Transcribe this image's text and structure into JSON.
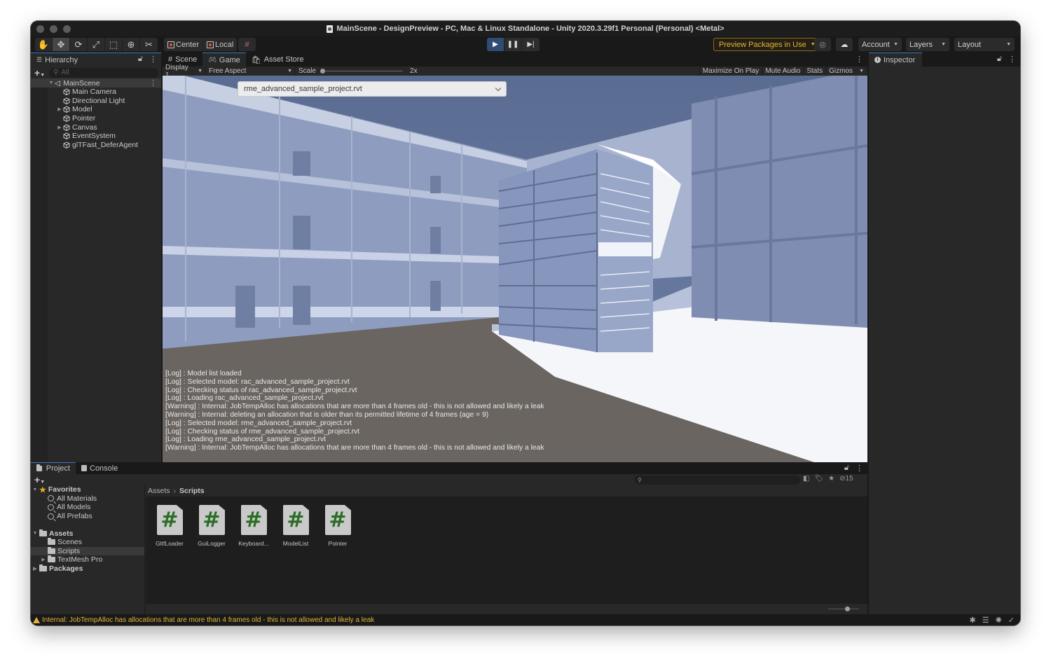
{
  "window": {
    "title": "MainScene - DesignPreview - PC, Mac & Linux Standalone - Unity 2020.3.29f1 Personal (Personal) <Metal>"
  },
  "toolbar": {
    "tools": [
      {
        "name": "hand-tool",
        "glyph": "✋"
      },
      {
        "name": "move-tool",
        "glyph": "✥"
      },
      {
        "name": "rotate-tool",
        "glyph": "⟳"
      },
      {
        "name": "scale-tool",
        "glyph": "⤢"
      },
      {
        "name": "rect-tool",
        "glyph": "⬚"
      },
      {
        "name": "transform-tool",
        "glyph": "⊕"
      },
      {
        "name": "custom-tool",
        "glyph": "✂"
      }
    ],
    "pivot_label": "Center",
    "space_label": "Local",
    "grid_snap_glyph": "#",
    "preview_packages_label": "Preview Packages in Use",
    "account_label": "Account",
    "layers_label": "Layers",
    "layout_label": "Layout"
  },
  "hierarchy": {
    "tab_label": "Hierarchy",
    "search_placeholder": "All",
    "scene": "MainScene",
    "items": [
      {
        "label": "Main Camera",
        "expandable": false
      },
      {
        "label": "Directional Light",
        "expandable": false
      },
      {
        "label": "Model",
        "expandable": true
      },
      {
        "label": "Pointer",
        "expandable": false
      },
      {
        "label": "Canvas",
        "expandable": true
      },
      {
        "label": "EventSystem",
        "expandable": false
      },
      {
        "label": "glTFast_DeferAgent",
        "expandable": false
      }
    ]
  },
  "game_view": {
    "tabs": [
      {
        "label": "Scene",
        "active": false
      },
      {
        "label": "Game",
        "active": true
      },
      {
        "label": "Asset Store",
        "active": false
      }
    ],
    "display": "Display 1",
    "aspect": "Free Aspect",
    "scale_label": "Scale",
    "scale_value": "2x",
    "scale_fraction": 0.0,
    "options": [
      "Maximize On Play",
      "Mute Audio",
      "Stats",
      "Gizmos"
    ],
    "model_dropdown_value": "rme_advanced_sample_project.rvt",
    "log_lines": [
      "[Log] : Model list loaded",
      "[Log] : Selected model: rac_advanced_sample_project.rvt",
      "[Log] : Checking status of rac_advanced_sample_project.rvt",
      "[Log] : Loading rac_advanced_sample_project.rvt",
      "[Warning] : Internal: JobTempAlloc has allocations that are more than 4 frames old - this is not allowed and likely a leak",
      "[Warning] : Internal: deleting an allocation that is older than its permitted lifetime of 4 frames (age = 9)",
      "[Log] : Selected model: rme_advanced_sample_project.rvt",
      "[Log] : Checking status of rme_advanced_sample_project.rvt",
      "[Log] : Loading rme_advanced_sample_project.rvt",
      "[Warning] : Internal: JobTempAlloc has allocations that are more than 4 frames old - this is not allowed and likely a leak"
    ]
  },
  "inspector": {
    "tab_label": "Inspector"
  },
  "project": {
    "tabs": [
      {
        "label": "Project",
        "active": true
      },
      {
        "label": "Console",
        "active": false
      }
    ],
    "hidden_count": "15",
    "favorites_label": "Favorites",
    "favorites": [
      "All Materials",
      "All Models",
      "All Prefabs"
    ],
    "assets_label": "Assets",
    "asset_folders": [
      {
        "label": "Scenes",
        "expandable": false,
        "selected": false
      },
      {
        "label": "Scripts",
        "expandable": false,
        "selected": true
      },
      {
        "label": "TextMesh Pro",
        "expandable": true,
        "selected": false
      }
    ],
    "packages_label": "Packages",
    "breadcrumb": [
      "Assets",
      "Scripts"
    ],
    "files": [
      "GltfLoader",
      "GuiLogger",
      "Keyboard...",
      "ModelList",
      "Pointer"
    ]
  },
  "status_bar": {
    "message": "Internal: JobTempAlloc has allocations that are more than 4 frames old - this is not allowed and likely a leak"
  },
  "colors": {
    "accent_play": "#2f4d72",
    "warning": "#e2b43a",
    "script_hash": "#2a6d25"
  }
}
